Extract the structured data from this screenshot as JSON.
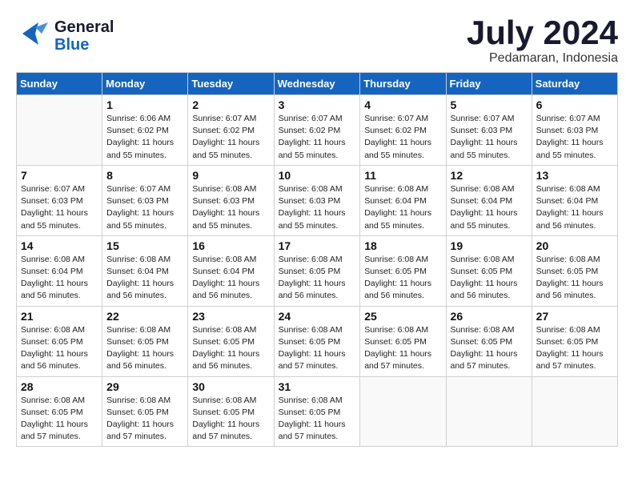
{
  "logo": {
    "line1": "General",
    "line2": "Blue"
  },
  "title": {
    "month_year": "July 2024",
    "location": "Pedamaran, Indonesia"
  },
  "weekdays": [
    "Sunday",
    "Monday",
    "Tuesday",
    "Wednesday",
    "Thursday",
    "Friday",
    "Saturday"
  ],
  "weeks": [
    [
      {
        "day": "",
        "info": ""
      },
      {
        "day": "1",
        "info": "Sunrise: 6:06 AM\nSunset: 6:02 PM\nDaylight: 11 hours\nand 55 minutes."
      },
      {
        "day": "2",
        "info": "Sunrise: 6:07 AM\nSunset: 6:02 PM\nDaylight: 11 hours\nand 55 minutes."
      },
      {
        "day": "3",
        "info": "Sunrise: 6:07 AM\nSunset: 6:02 PM\nDaylight: 11 hours\nand 55 minutes."
      },
      {
        "day": "4",
        "info": "Sunrise: 6:07 AM\nSunset: 6:02 PM\nDaylight: 11 hours\nand 55 minutes."
      },
      {
        "day": "5",
        "info": "Sunrise: 6:07 AM\nSunset: 6:03 PM\nDaylight: 11 hours\nand 55 minutes."
      },
      {
        "day": "6",
        "info": "Sunrise: 6:07 AM\nSunset: 6:03 PM\nDaylight: 11 hours\nand 55 minutes."
      }
    ],
    [
      {
        "day": "7",
        "info": "Sunrise: 6:07 AM\nSunset: 6:03 PM\nDaylight: 11 hours\nand 55 minutes."
      },
      {
        "day": "8",
        "info": "Sunrise: 6:07 AM\nSunset: 6:03 PM\nDaylight: 11 hours\nand 55 minutes."
      },
      {
        "day": "9",
        "info": "Sunrise: 6:08 AM\nSunset: 6:03 PM\nDaylight: 11 hours\nand 55 minutes."
      },
      {
        "day": "10",
        "info": "Sunrise: 6:08 AM\nSunset: 6:03 PM\nDaylight: 11 hours\nand 55 minutes."
      },
      {
        "day": "11",
        "info": "Sunrise: 6:08 AM\nSunset: 6:04 PM\nDaylight: 11 hours\nand 55 minutes."
      },
      {
        "day": "12",
        "info": "Sunrise: 6:08 AM\nSunset: 6:04 PM\nDaylight: 11 hours\nand 55 minutes."
      },
      {
        "day": "13",
        "info": "Sunrise: 6:08 AM\nSunset: 6:04 PM\nDaylight: 11 hours\nand 56 minutes."
      }
    ],
    [
      {
        "day": "14",
        "info": "Sunrise: 6:08 AM\nSunset: 6:04 PM\nDaylight: 11 hours\nand 56 minutes."
      },
      {
        "day": "15",
        "info": "Sunrise: 6:08 AM\nSunset: 6:04 PM\nDaylight: 11 hours\nand 56 minutes."
      },
      {
        "day": "16",
        "info": "Sunrise: 6:08 AM\nSunset: 6:04 PM\nDaylight: 11 hours\nand 56 minutes."
      },
      {
        "day": "17",
        "info": "Sunrise: 6:08 AM\nSunset: 6:05 PM\nDaylight: 11 hours\nand 56 minutes."
      },
      {
        "day": "18",
        "info": "Sunrise: 6:08 AM\nSunset: 6:05 PM\nDaylight: 11 hours\nand 56 minutes."
      },
      {
        "day": "19",
        "info": "Sunrise: 6:08 AM\nSunset: 6:05 PM\nDaylight: 11 hours\nand 56 minutes."
      },
      {
        "day": "20",
        "info": "Sunrise: 6:08 AM\nSunset: 6:05 PM\nDaylight: 11 hours\nand 56 minutes."
      }
    ],
    [
      {
        "day": "21",
        "info": "Sunrise: 6:08 AM\nSunset: 6:05 PM\nDaylight: 11 hours\nand 56 minutes."
      },
      {
        "day": "22",
        "info": "Sunrise: 6:08 AM\nSunset: 6:05 PM\nDaylight: 11 hours\nand 56 minutes."
      },
      {
        "day": "23",
        "info": "Sunrise: 6:08 AM\nSunset: 6:05 PM\nDaylight: 11 hours\nand 56 minutes."
      },
      {
        "day": "24",
        "info": "Sunrise: 6:08 AM\nSunset: 6:05 PM\nDaylight: 11 hours\nand 57 minutes."
      },
      {
        "day": "25",
        "info": "Sunrise: 6:08 AM\nSunset: 6:05 PM\nDaylight: 11 hours\nand 57 minutes."
      },
      {
        "day": "26",
        "info": "Sunrise: 6:08 AM\nSunset: 6:05 PM\nDaylight: 11 hours\nand 57 minutes."
      },
      {
        "day": "27",
        "info": "Sunrise: 6:08 AM\nSunset: 6:05 PM\nDaylight: 11 hours\nand 57 minutes."
      }
    ],
    [
      {
        "day": "28",
        "info": "Sunrise: 6:08 AM\nSunset: 6:05 PM\nDaylight: 11 hours\nand 57 minutes."
      },
      {
        "day": "29",
        "info": "Sunrise: 6:08 AM\nSunset: 6:05 PM\nDaylight: 11 hours\nand 57 minutes."
      },
      {
        "day": "30",
        "info": "Sunrise: 6:08 AM\nSunset: 6:05 PM\nDaylight: 11 hours\nand 57 minutes."
      },
      {
        "day": "31",
        "info": "Sunrise: 6:08 AM\nSunset: 6:05 PM\nDaylight: 11 hours\nand 57 minutes."
      },
      {
        "day": "",
        "info": ""
      },
      {
        "day": "",
        "info": ""
      },
      {
        "day": "",
        "info": ""
      }
    ]
  ]
}
